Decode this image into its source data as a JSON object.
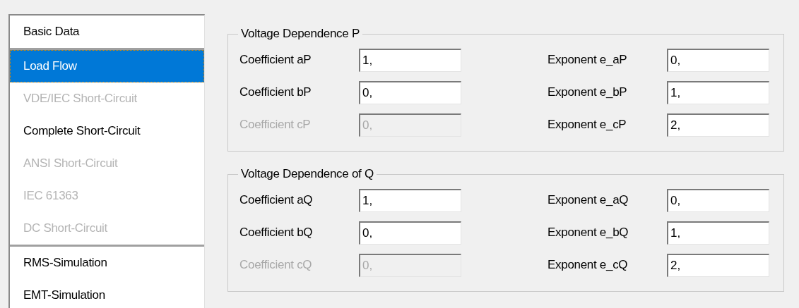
{
  "sidebar": {
    "groups": [
      {
        "items": [
          {
            "label": "Basic Data",
            "selected": false,
            "disabled": false
          }
        ]
      },
      {
        "items": [
          {
            "label": "Load Flow",
            "selected": true,
            "disabled": false
          },
          {
            "label": "VDE/IEC Short-Circuit",
            "selected": false,
            "disabled": true
          },
          {
            "label": "Complete Short-Circuit",
            "selected": false,
            "disabled": false
          },
          {
            "label": "ANSI Short-Circuit",
            "selected": false,
            "disabled": true
          },
          {
            "label": "IEC 61363",
            "selected": false,
            "disabled": true
          },
          {
            "label": "DC Short-Circuit",
            "selected": false,
            "disabled": true
          }
        ]
      },
      {
        "items": [
          {
            "label": "RMS-Simulation",
            "selected": false,
            "disabled": false
          },
          {
            "label": "EMT-Simulation",
            "selected": false,
            "disabled": false
          }
        ]
      }
    ]
  },
  "groupboxes": [
    {
      "title": "Voltage Dependence P",
      "rows": [
        [
          {
            "label": "Coefficient aP",
            "value": "1,",
            "disabled": false
          },
          {
            "label": "Exponent e_aP",
            "value": "0,",
            "disabled": false
          }
        ],
        [
          {
            "label": "Coefficient bP",
            "value": "0,",
            "disabled": false
          },
          {
            "label": "Exponent e_bP",
            "value": "1,",
            "disabled": false
          }
        ],
        [
          {
            "label": "Coefficient cP",
            "value": "0,",
            "disabled": true
          },
          {
            "label": "Exponent e_cP",
            "value": "2,",
            "disabled": false
          }
        ]
      ]
    },
    {
      "title": "Voltage Dependence of Q",
      "rows": [
        [
          {
            "label": "Coefficient aQ",
            "value": "1,",
            "disabled": false
          },
          {
            "label": "Exponent e_aQ",
            "value": "0,",
            "disabled": false
          }
        ],
        [
          {
            "label": "Coefficient bQ",
            "value": "0,",
            "disabled": false
          },
          {
            "label": "Exponent e_bQ",
            "value": "1,",
            "disabled": false
          }
        ],
        [
          {
            "label": "Coefficient cQ",
            "value": "0,",
            "disabled": true
          },
          {
            "label": "Exponent e_cQ",
            "value": "2,",
            "disabled": false
          }
        ]
      ]
    }
  ]
}
